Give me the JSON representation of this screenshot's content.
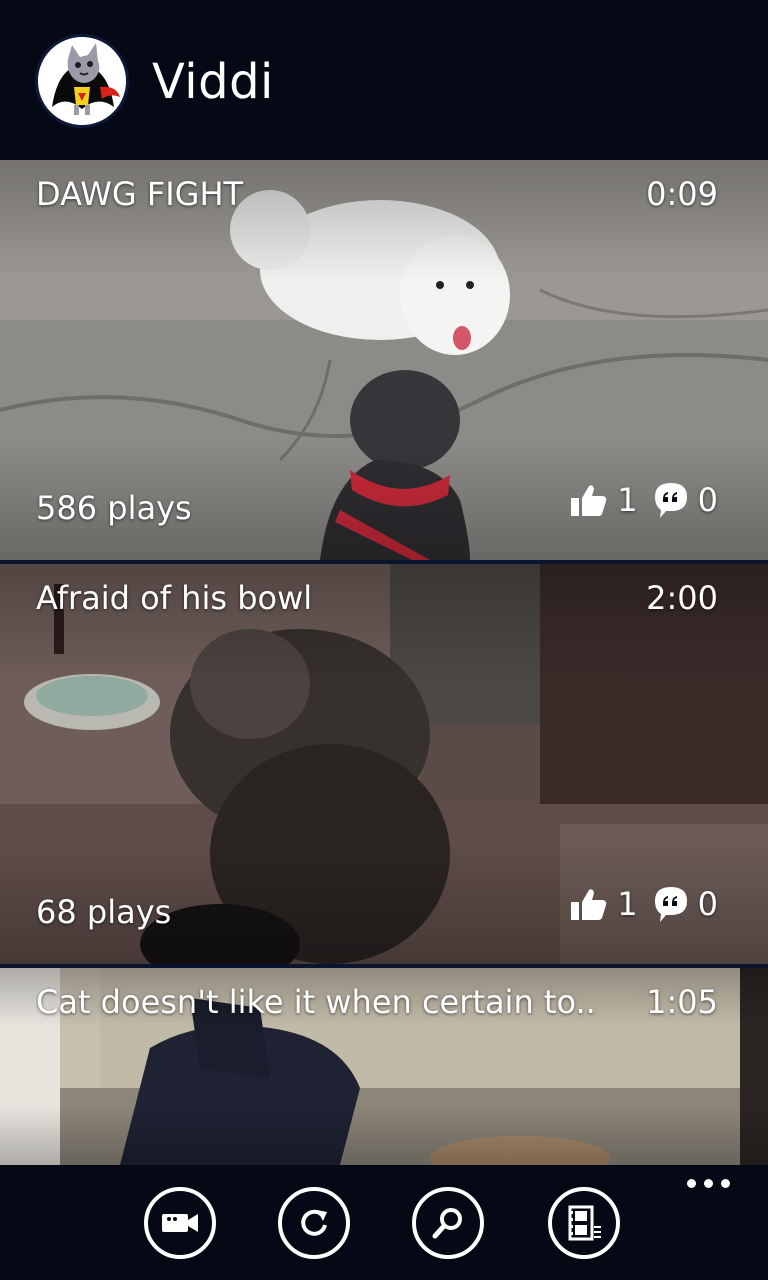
{
  "app": {
    "title": "Viddi"
  },
  "videos": [
    {
      "title": "DAWG FIGHT",
      "duration": "0:09",
      "plays": "586 plays",
      "likes": "1",
      "comments": "0"
    },
    {
      "title": "Afraid of his bowl",
      "duration": "2:00",
      "plays": "68 plays",
      "likes": "1",
      "comments": "0"
    },
    {
      "title": "Cat doesn't like it when certain to...",
      "duration": "1:05"
    }
  ],
  "appbar": {
    "buttons": [
      {
        "icon": "video-camera-icon"
      },
      {
        "icon": "refresh-icon"
      },
      {
        "icon": "search-icon"
      },
      {
        "icon": "film-list-icon"
      }
    ],
    "more_icon": "ellipsis-icon"
  }
}
